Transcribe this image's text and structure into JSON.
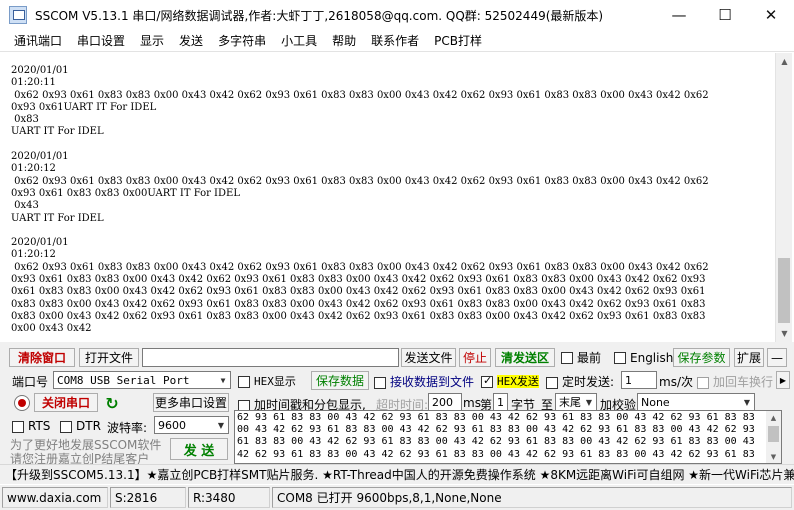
{
  "window": {
    "title": "SSCOM V5.13.1 串口/网络数据调试器,作者:大虾丁丁,2618058@qq.com. QQ群: 52502449(最新版本)",
    "minimize_glyph": "—",
    "maximize_glyph": "☐",
    "close_glyph": "✕"
  },
  "menu": [
    {
      "label": "通讯端口"
    },
    {
      "label": "串口设置"
    },
    {
      "label": "显示"
    },
    {
      "label": "发送"
    },
    {
      "label": "多字符串"
    },
    {
      "label": "小工具"
    },
    {
      "label": "帮助"
    },
    {
      "label": "联系作者"
    },
    {
      "label": "PCB打样"
    }
  ],
  "receive": {
    "lines": [
      "2020/01/01",
      "01:20:11",
      " 0x62 0x93 0x61 0x83 0x83 0x00 0x43 0x42 0x62 0x93 0x61 0x83 0x83 0x00 0x43 0x42 0x62 0x93 0x61 0x83 0x83 0x00 0x43 0x42 0x62",
      "0x93 0x61UART IT For IDEL",
      " 0x83",
      "UART IT For IDEL",
      "",
      "2020/01/01",
      "01:20:12",
      " 0x62 0x93 0x61 0x83 0x83 0x00 0x43 0x42 0x62 0x93 0x61 0x83 0x83 0x00 0x43 0x42 0x62 0x93 0x61 0x83 0x83 0x00 0x43 0x42 0x62",
      "0x93 0x61 0x83 0x83 0x00UART IT For IDEL",
      " 0x43",
      "UART IT For IDEL",
      "",
      "2020/01/01",
      "01:20:12",
      " 0x62 0x93 0x61 0x83 0x83 0x00 0x43 0x42 0x62 0x93 0x61 0x83 0x83 0x00 0x43 0x42 0x62 0x93 0x61 0x83 0x83 0x00 0x43 0x42 0x62",
      "0x93 0x61 0x83 0x83 0x00 0x43 0x42 0x62 0x93 0x61 0x83 0x83 0x00 0x43 0x42 0x62 0x93 0x61 0x83 0x83 0x00 0x43 0x42 0x62 0x93",
      "0x61 0x83 0x83 0x00 0x43 0x42 0x62 0x93 0x61 0x83 0x83 0x00 0x43 0x42 0x62 0x93 0x61 0x83 0x83 0x00 0x43 0x42 0x62 0x93 0x61",
      "0x83 0x83 0x00 0x43 0x42 0x62 0x93 0x61 0x83 0x83 0x00 0x43 0x42 0x62 0x93 0x61 0x83 0x83 0x00 0x43 0x42 0x62 0x93 0x61 0x83",
      "0x83 0x00 0x43 0x42 0x62 0x93 0x61 0x83 0x83 0x00 0x43 0x42 0x62 0x93 0x61 0x83 0x83 0x00 0x43 0x42 0x62 0x93 0x61 0x83 0x83",
      "0x00 0x43 0x42"
    ]
  },
  "toolbar": {
    "clear_window": "清除窗口",
    "open_file": "打开文件",
    "send_file": "发送文件",
    "stop": "停止",
    "clear_send_area": "清发送区",
    "topmost": "最前",
    "english": "English",
    "save_params": "保存参数",
    "expand": "扩展",
    "collapse_glyph": "—"
  },
  "panel": {
    "port_label": "端口号",
    "port_value": "COM8 USB Serial Port",
    "hex_display": "HEX显示",
    "save_data": "保存数据",
    "recv_to_file": "接收数据到文件",
    "hex_send": "HEX发送",
    "timed_send": "定时发送:",
    "timed_ms": "1",
    "ms_per": "ms/次",
    "add_crlf": "加回车换行",
    "close_port": "关闭串口",
    "more_settings": "更多串口设置",
    "add_timestamp": "加时间戳和分包显示,",
    "timeout_label": "超时时间:",
    "timeout_value": "200",
    "ms": "ms",
    "byte_prefix": "第",
    "byte_index": "1",
    "byte_unit": "字节",
    "to": "至",
    "end_value": "末尾",
    "checksum_label": "加校验",
    "checksum_value": "None",
    "rts": "RTS",
    "dtr": "DTR",
    "baud_label": "波特率:",
    "baud_value": "9600",
    "promo_line1": "为了更好地发展SSCOM软件",
    "promo_line2": "请您注册嘉立创P结尾客户",
    "send": "发 送",
    "send_lines": [
      "62 93 61 83 83 00 43 42 62 93 61 83 83 00 43 42 62 93 61 83 83 00 43 42 62 93 61 83 83",
      "00 43 42 62 93 61 83 83 00 43 42 62 93 61 83 83 00 43 42 62 93 61 83 83 00 43 42 62 93",
      "61 83 83 00 43 42 62 93 61 83 83 00 43 42 62 93 61 83 83 00 43 42 62 93 61 83 83 00 43",
      "42 62 93 61 83 83 00 43 42 62 93 61 83 83 00 43 42 62 93 61 83 83 00 43 42 62 93 61 83"
    ]
  },
  "marquee": "【升级到SSCOM5.13.1】★嘉立创PCB打样SMT贴片服务. ★RT-Thread中国人的开源免费操作系统 ★8KM远距离WiFi可自组网 ★新一代WiFi芯片兼容8",
  "status": {
    "website": "www.daxia.com",
    "sent": "S:2816",
    "received": "R:3480",
    "port_status": "COM8 已打开  9600bps,8,1,None,None"
  },
  "colors": {
    "accent_red": "#c00000",
    "accent_green": "#008000",
    "hex_send_highlight": "#ffff00",
    "panel_bg": "#f0f0f0"
  }
}
